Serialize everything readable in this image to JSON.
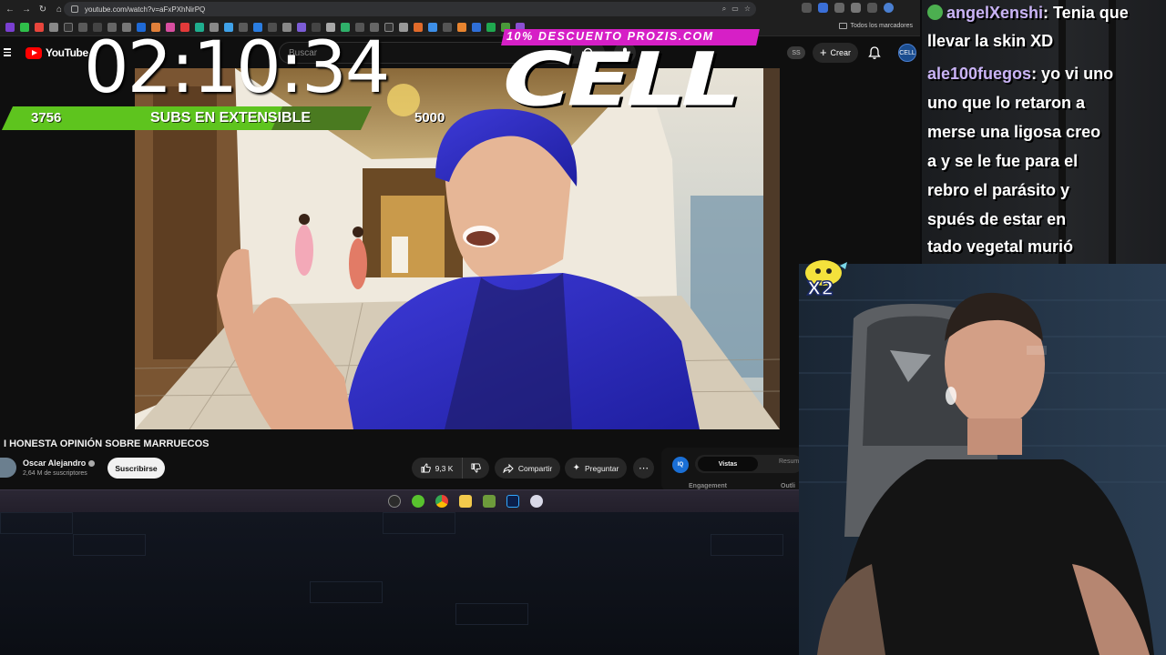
{
  "browser": {
    "url": "youtube.com/watch?v=aFxPXhNirPQ",
    "bookmark_folder": "Todos los marcadores"
  },
  "youtube": {
    "logo_text": "YouTube",
    "search_placeholder": "Buscar",
    "ss_badge": "SS",
    "create_label": "Crear",
    "avatar_text": "CELL"
  },
  "video": {
    "title": "I HONESTA OPINIÓN SOBRE MARRUECOS",
    "channel_name": "Oscar Alejandro",
    "channel_subs": "2,64 M de suscriptores",
    "subscribe_label": "Suscribirse",
    "likes": "9,3 K",
    "share_label": "Compartir",
    "ask_label": "Preguntar",
    "more_label": "⋯"
  },
  "side_panel": {
    "icon_text": "IQ",
    "tab_active": "Vistas",
    "tab_inactive": "Resum",
    "section_1": "Engagement",
    "section_2": "Outli"
  },
  "chat": {
    "messages": [
      {
        "user": "angelXenshi",
        "text": ": Tenia que"
      },
      {
        "user": "",
        "text": "llevar la skin XD"
      },
      {
        "user": "ale100fuegos",
        "text": ": yo vi uno"
      },
      {
        "user": "",
        "text": "uno que lo retaron a"
      },
      {
        "user": "",
        "text": "merse una ligosa creo"
      },
      {
        "user": "",
        "text": "a y se le fue para el"
      },
      {
        "user": "",
        "text": "rebro el parásito y"
      },
      {
        "user": "",
        "text": "spués de estar en"
      },
      {
        "user": "",
        "text": "tado vegetal murió"
      }
    ]
  },
  "overlay": {
    "x2_label": "X2",
    "timer": "02:10:34",
    "subs_current": 3756,
    "subs_goal": 5000,
    "subs_label": "SUBS EN EXTENSIBLE",
    "promo": "10% DESCUENTO PROZIS.COM",
    "brand": "CELL"
  },
  "colors": {
    "yt_red": "#ff0000",
    "subs_green": "#5ec41e",
    "promo_magenta": "#d61fc6",
    "chat_user": "#c9b3f5"
  }
}
